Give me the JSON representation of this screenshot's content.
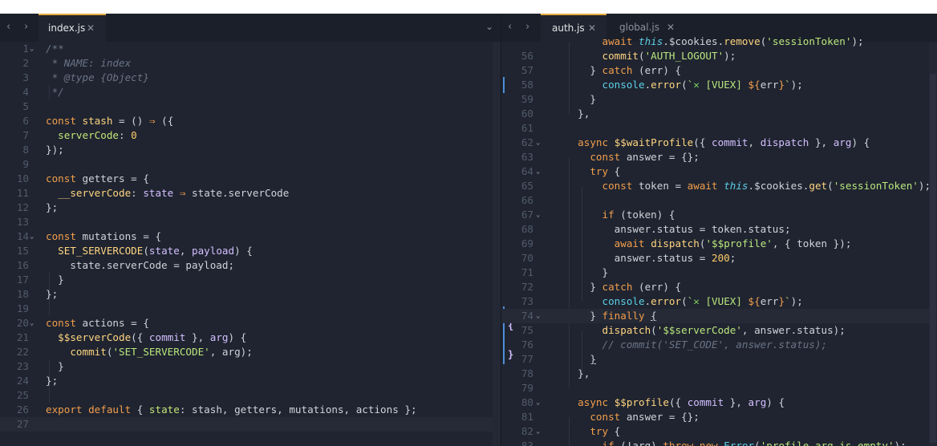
{
  "left": {
    "tab": {
      "label": "index.js",
      "close": "✕"
    },
    "nav": {
      "back": "‹",
      "forward": "›",
      "dropdown": "⌄"
    },
    "lines": [
      {
        "n": "1",
        "fold": true,
        "h": "<span class=\"cm\">/**</span>"
      },
      {
        "n": "2",
        "h": "<span class=\"cm\"> * NAME: index</span>"
      },
      {
        "n": "3",
        "h": "<span class=\"cm\"> * @type {Object}</span>"
      },
      {
        "n": "4",
        "h": "<span class=\"cm\"> */</span>"
      },
      {
        "n": "5",
        "h": ""
      },
      {
        "n": "6",
        "h": "<span class=\"kw\">const</span> <span class=\"fn\">stash</span> = () <span class=\"kw\">⇒</span> ({"
      },
      {
        "n": "7",
        "h": "  <span class=\"prop\">serverCode</span>: <span class=\"num\">0</span>"
      },
      {
        "n": "8",
        "h": "});"
      },
      {
        "n": "9",
        "h": ""
      },
      {
        "n": "10",
        "h": "<span class=\"kw\">const</span> getters = {"
      },
      {
        "n": "11",
        "h": "  <span class=\"fn\">__serverCode</span>: <span class=\"pa\">state</span> <span class=\"kw\">⇒</span> state.serverCode"
      },
      {
        "n": "12",
        "h": "};"
      },
      {
        "n": "13",
        "h": ""
      },
      {
        "n": "14",
        "fold": true,
        "h": "<span class=\"kw\">const</span> mutations = {"
      },
      {
        "n": "15",
        "h": "  <span class=\"fn\">SET_SERVERCODE</span>(<span class=\"pa\">state</span>, <span class=\"pa\">payload</span>) {"
      },
      {
        "n": "16",
        "h": "    state.serverCode = payload;"
      },
      {
        "n": "17",
        "h": "  }"
      },
      {
        "n": "18",
        "h": "};"
      },
      {
        "n": "19",
        "h": ""
      },
      {
        "n": "20",
        "fold": true,
        "h": "<span class=\"kw\">const</span> actions = {"
      },
      {
        "n": "21",
        "h": "  <span class=\"fn\">$$serverCode</span>({ <span class=\"pa\">commit</span> }, <span class=\"pa\">arg</span>) {"
      },
      {
        "n": "22",
        "h": "    <span class=\"fn\">commit</span>(<span class=\"str\">'SET_SERVERCODE'</span>, arg);"
      },
      {
        "n": "23",
        "h": "  }"
      },
      {
        "n": "24",
        "h": "};"
      },
      {
        "n": "25",
        "h": ""
      },
      {
        "n": "26",
        "h": "<span class=\"kw\">export</span> <span class=\"kw\">default</span> { <span class=\"prop\">state</span>: stash, getters, mutations, actions };"
      },
      {
        "n": "27",
        "cur": true,
        "h": ""
      }
    ]
  },
  "right": {
    "tabs": [
      {
        "label": "auth.js",
        "close": "✕",
        "active": true
      },
      {
        "label": "global.js",
        "close": "✕",
        "active": false
      }
    ],
    "nav": {
      "back": "‹",
      "forward": "›"
    },
    "partial_top": "      <span class=\"kw\">await</span> <span class=\"ths\">this</span>.$cookies.<span class=\"fn\">remove</span>(<span class=\"str\">'sessionToken'</span>);",
    "lines": [
      {
        "n": "56",
        "h": "      <span class=\"fn\">commit</span>(<span class=\"str\">'AUTH_LOGOUT'</span>);"
      },
      {
        "n": "57",
        "h": "    } <span class=\"kw\">catch</span> (err) {"
      },
      {
        "n": "58",
        "h": "      <span class=\"cn\">console</span>.<span class=\"fn\">error</span>(<span class=\"str\">`</span><span class=\"x\">✕</span><span class=\"str\"> [VUEX] </span><span class=\"kw\">${</span>err<span class=\"kw\">}</span><span class=\"str\">`</span>);"
      },
      {
        "n": "59",
        "h": "    }"
      },
      {
        "n": "60",
        "h": "  },"
      },
      {
        "n": "61",
        "h": ""
      },
      {
        "n": "62",
        "fold": true,
        "h": "  <span class=\"kw\">async</span> <span class=\"fn\">$$waitProfile</span>({ <span class=\"pa\">commit</span>, <span class=\"pa\">dispatch</span> }, <span class=\"pa\">arg</span>) {"
      },
      {
        "n": "63",
        "h": "    <span class=\"kw\">const</span> answer = {};"
      },
      {
        "n": "64",
        "fold": true,
        "h": "    <span class=\"kw\">try</span> {"
      },
      {
        "n": "65",
        "h": "      <span class=\"kw\">const</span> token = <span class=\"kw\">await</span> <span class=\"ths\">this</span>.$cookies.<span class=\"fn\">get</span>(<span class=\"str\">'sessionToken'</span>);"
      },
      {
        "n": "66",
        "h": ""
      },
      {
        "n": "67",
        "fold": true,
        "h": "      <span class=\"kw\">if</span> (token) {"
      },
      {
        "n": "68",
        "h": "        answer.status = token.status;"
      },
      {
        "n": "69",
        "h": "        <span class=\"kw\">await</span> <span class=\"fn\">dispatch</span>(<span class=\"str\">'$$profile'</span>, { token });"
      },
      {
        "n": "70",
        "h": "        answer.status = <span class=\"num\">200</span>;"
      },
      {
        "n": "71",
        "h": "      }"
      },
      {
        "n": "72",
        "h": "    } <span class=\"kw\">catch</span> (err) {"
      },
      {
        "n": "73",
        "h": "      <span class=\"cn\">console</span>.<span class=\"fn\">error</span>(<span class=\"str\">`</span><span class=\"x\">✕</span><span class=\"str\"> [VUEX] </span><span class=\"kw\">${</span>err<span class=\"kw\">}</span><span class=\"str\">`</span>);"
      },
      {
        "n": "74",
        "fold": true,
        "cur": true,
        "h": "    } <span class=\"kw\">finally</span> <u>{</u>"
      },
      {
        "n": "75",
        "h": "      <span class=\"fn\">dispatch</span>(<span class=\"str\">'$$serverCode'</span>, answer.status);"
      },
      {
        "n": "76",
        "h": "      <span class=\"cm\">// commit('SET_CODE', answer.status);</span>"
      },
      {
        "n": "77",
        "h": "    <u>}</u>"
      },
      {
        "n": "78",
        "h": "  },"
      },
      {
        "n": "79",
        "h": ""
      },
      {
        "n": "80",
        "fold": true,
        "h": "  <span class=\"kw\">async</span> <span class=\"fn\">$$profile</span>({ <span class=\"pa\">commit</span> }, <span class=\"pa\">arg</span>) {"
      },
      {
        "n": "81",
        "h": "    <span class=\"kw\">const</span> answer = {};"
      },
      {
        "n": "82",
        "fold": true,
        "h": "    <span class=\"kw\">try</span> {"
      },
      {
        "n": "83",
        "h": "      <span class=\"kw\">if</span> (!arg) <span class=\"kw\">throw</span> <span class=\"kw\">new</span> <span class=\"cn\">Error</span>(<span class=\"str\">'profile arg is empty'</span>);"
      }
    ],
    "gutter_brackets": {
      "open": "{",
      "close": "}"
    }
  },
  "colors": {
    "background": "#1f2430",
    "accent": "#e6a93d",
    "keyword": "#f29e4c",
    "function": "#ffd580",
    "string": "#bae67e"
  }
}
